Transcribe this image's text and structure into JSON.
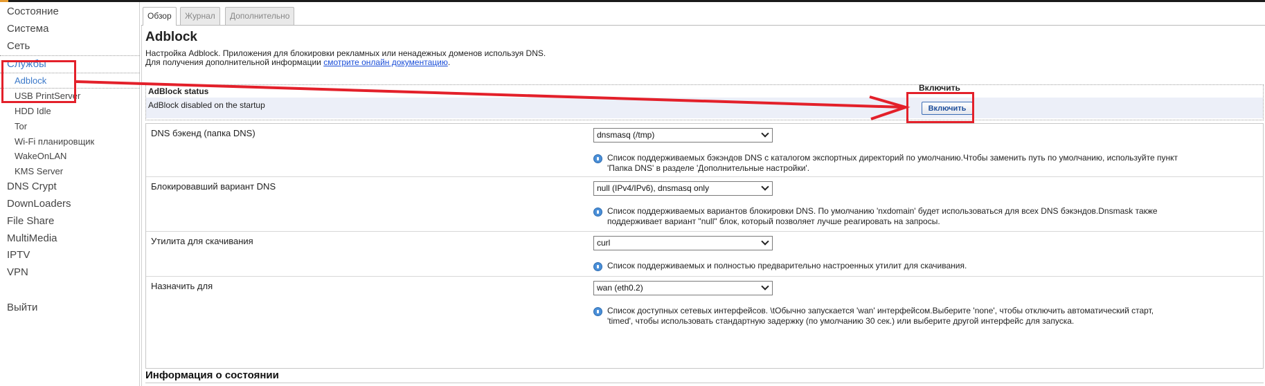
{
  "sidebar": {
    "top_items": [
      "Состояние",
      "Система",
      "Сеть"
    ],
    "services_label": "Службы",
    "services_sub": [
      "Adblock",
      "USB PrintServer",
      "HDD Idle",
      "Tor",
      "Wi-Fi планировщик",
      "WakeOnLAN",
      "KMS Server"
    ],
    "bottom_items": [
      "DNS Crypt",
      "DownLoaders",
      "File Share",
      "MultiMedia",
      "IPTV",
      "VPN"
    ],
    "logout": "Выйти"
  },
  "tabs": [
    "Обзор",
    "Журнал",
    "Дополнительно"
  ],
  "page": {
    "title": "Adblock",
    "desc_line1": "Настройка Adblock. Приложения для блокировки рекламных или ненадежных доменов используя DNS.",
    "desc_line2_prefix": "Для получения дополнительной информации ",
    "desc_link": "смотрите онлайн документацию",
    "desc_line2_suffix": "."
  },
  "status": {
    "col1_header": "AdBlock status",
    "col2_header": "Включить",
    "value": "AdBlock disabled on the startup",
    "button": "Включить"
  },
  "settings": [
    {
      "label": "DNS бэкенд (папка DNS)",
      "value": "dnsmasq (/tmp)",
      "help_line1": "Список поддерживаемых бэкэндов DNS с каталогом экспортных директорий по умолчанию.Чтобы заменить путь по умолчанию, используйте пункт",
      "help_line2": "'Папка DNS' в разделе 'Дополнительные настройки'."
    },
    {
      "label": "Блокировавший вариант DNS",
      "value": "null (IPv4/IPv6), dnsmasq only",
      "help_line1": "Список поддерживаемых вариантов блокировки DNS. По умолчанию 'nxdomain' будет использоваться для всех DNS бэкэндов.Dnsmask также",
      "help_line2": "поддерживает вариант \"null\" блок, который позволяет лучше реагировать на запросы."
    },
    {
      "label": "Утилита для скачивания",
      "value": "curl",
      "help_line1": "Список поддерживаемых и полностью предварительно настроенных утилит для скачивания.",
      "help_line2": ""
    },
    {
      "label": "Назначить для",
      "value": "wan (eth0.2)",
      "help_line1": "Список доступных сетевых интерфейсов. \\tОбычно запускается 'wan' интерфейсом.Выберите 'none', чтобы отключить автоматический старт,",
      "help_line2": "'timed', чтобы использовать стандартную задержку (по умолчанию 30 сек.) или выберите другой интерфейс для запуска."
    }
  ],
  "section": {
    "title": "Информация о состоянии"
  },
  "colors": {
    "accent": "#e69a2e",
    "active_link": "#3a78c9",
    "annotation": "#e3202a",
    "button_text": "#1f4f9c"
  },
  "icons": [
    "info-icon",
    "chevron-down-icon"
  ]
}
